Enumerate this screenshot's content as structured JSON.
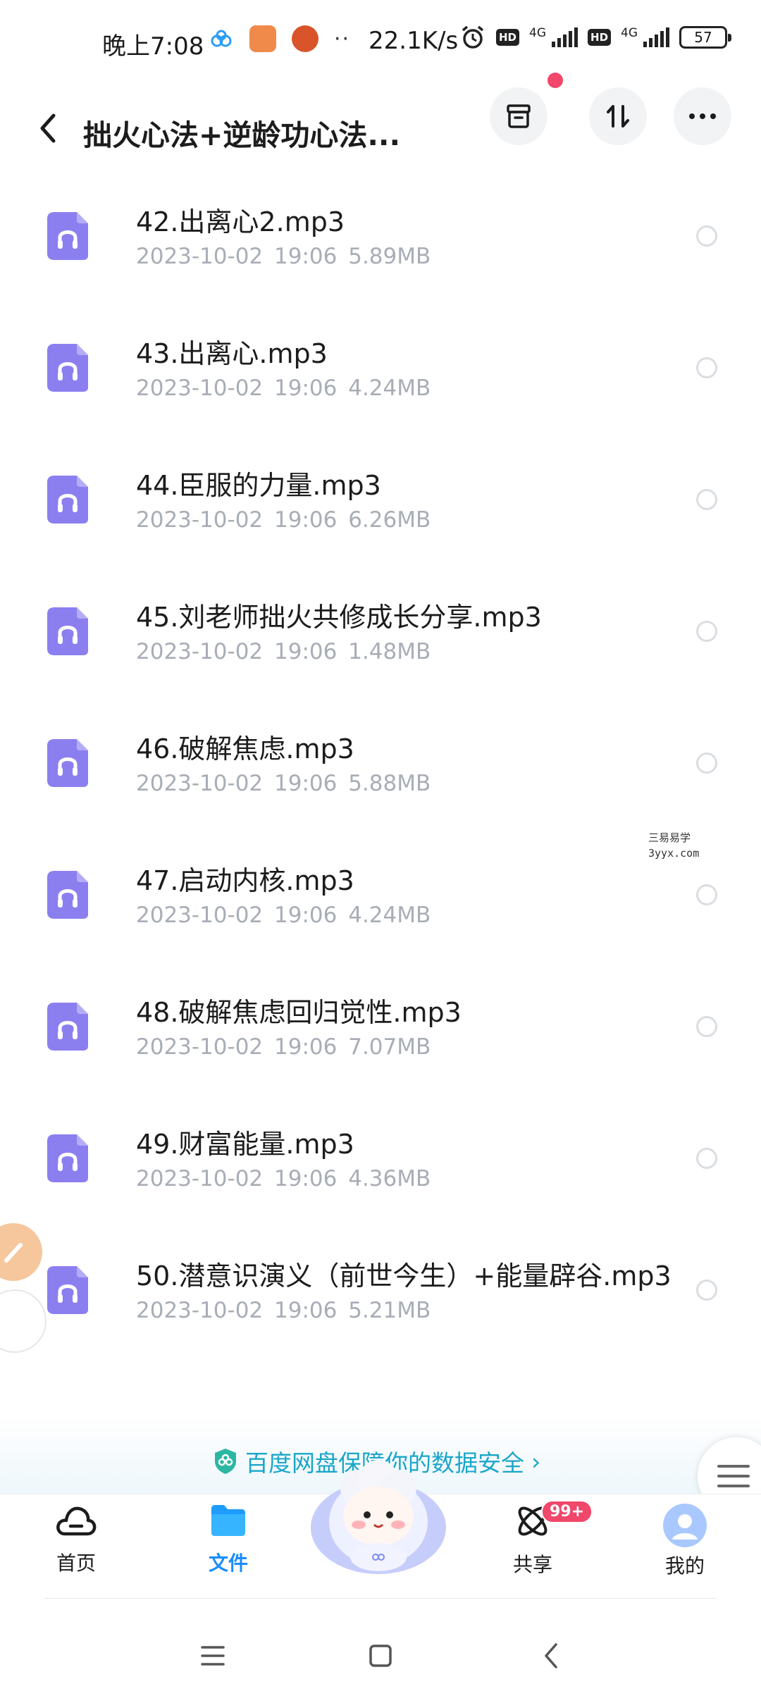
{
  "status_bar": {
    "time": "晚上7:08",
    "dots": "··",
    "net_speed": "22.1K/s",
    "hd1": "HD",
    "net1": "4G",
    "hd2": "HD",
    "net2": "4G",
    "battery": "57"
  },
  "header": {
    "title": "拙火心法+逆龄功心法..."
  },
  "files": [
    {
      "name": "42.出离心2.mp3",
      "date": "2023-10-02",
      "time": "19:06",
      "size": "5.89MB"
    },
    {
      "name": "43.出离心.mp3",
      "date": "2023-10-02",
      "time": "19:06",
      "size": "4.24MB"
    },
    {
      "name": "44.臣服的力量.mp3",
      "date": "2023-10-02",
      "time": "19:06",
      "size": "6.26MB"
    },
    {
      "name": "45.刘老师拙火共修成长分享.mp3",
      "date": "2023-10-02",
      "time": "19:06",
      "size": "1.48MB"
    },
    {
      "name": "46.破解焦虑.mp3",
      "date": "2023-10-02",
      "time": "19:06",
      "size": "5.88MB"
    },
    {
      "name": "47.启动内核.mp3",
      "date": "2023-10-02",
      "time": "19:06",
      "size": "4.24MB"
    },
    {
      "name": "48.破解焦虑回归觉性.mp3",
      "date": "2023-10-02",
      "time": "19:06",
      "size": "7.07MB"
    },
    {
      "name": "49.财富能量.mp3",
      "date": "2023-10-02",
      "time": "19:06",
      "size": "4.36MB"
    },
    {
      "name": "50.潜意识演义（前世今生）+能量辟谷.mp3",
      "date": "2023-10-02",
      "time": "19:06",
      "size": "5.21MB"
    }
  ],
  "watermark": {
    "line1": "三易易学",
    "line2": "3yyx.com"
  },
  "banner": {
    "text": "百度网盘保障你的数据安全",
    "arrow": "›"
  },
  "nav": {
    "home": "首页",
    "files": "文件",
    "share": "共享",
    "share_badge": "99+",
    "mine": "我的"
  },
  "colors": {
    "accent": "#1a8cff",
    "file_icon": "#8b7ff0",
    "badge": "#f0476a",
    "banner_text": "#1aa6c9"
  }
}
